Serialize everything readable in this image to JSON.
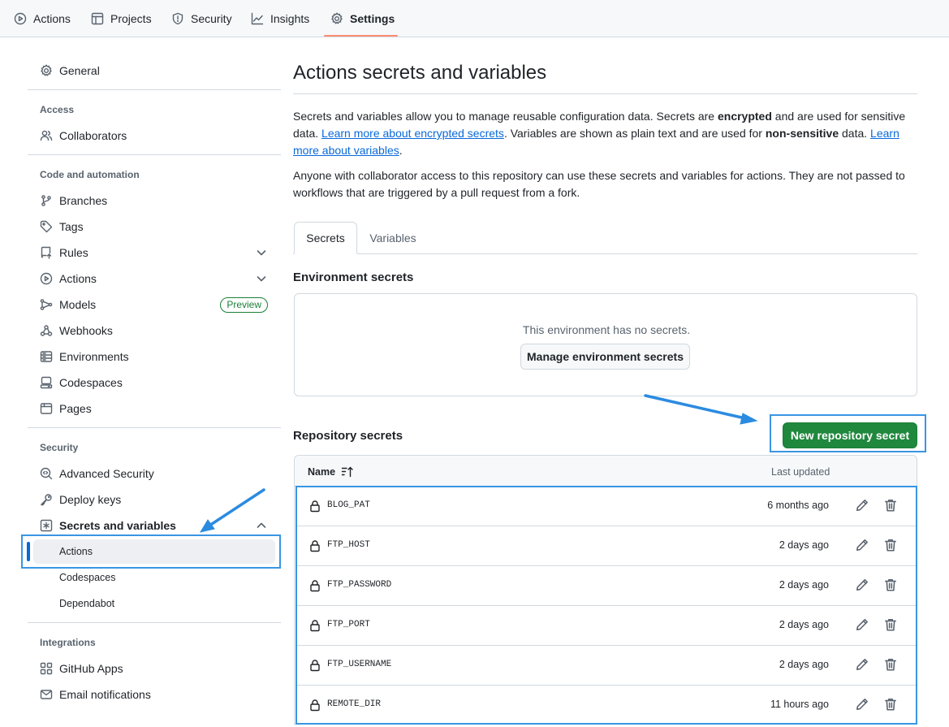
{
  "topnav": {
    "tabs": [
      {
        "label": "Actions",
        "icon": "play-icon"
      },
      {
        "label": "Projects",
        "icon": "table-icon"
      },
      {
        "label": "Security",
        "icon": "shield-icon"
      },
      {
        "label": "Insights",
        "icon": "graph-icon"
      },
      {
        "label": "Settings",
        "icon": "gear-icon",
        "active": true
      }
    ]
  },
  "sidebar": {
    "general": "General",
    "sections": {
      "access": "Access",
      "code_automation": "Code and automation",
      "security": "Security",
      "integrations": "Integrations"
    },
    "items": {
      "collaborators": "Collaborators",
      "branches": "Branches",
      "tags": "Tags",
      "rules": "Rules",
      "actions": "Actions",
      "models": "Models",
      "models_badge": "Preview",
      "webhooks": "Webhooks",
      "environments": "Environments",
      "codespaces": "Codespaces",
      "pages": "Pages",
      "advanced_security": "Advanced Security",
      "deploy_keys": "Deploy keys",
      "secrets_and_variables": "Secrets and variables",
      "sub_actions": "Actions",
      "sub_codespaces": "Codespaces",
      "sub_dependabot": "Dependabot",
      "github_apps": "GitHub Apps",
      "email_notifications": "Email notifications"
    }
  },
  "main": {
    "title": "Actions secrets and variables",
    "intro": {
      "t1": "Secrets and variables allow you to manage reusable configuration data. Secrets are ",
      "b1": "encrypted",
      "t2": " and are used for sensitive data. ",
      "link1": "Learn more about encrypted secrets",
      "t3": ". Variables are shown as plain text and are used for ",
      "b2": "non-sensitive",
      "t4": " data. ",
      "link2": "Learn more about variables",
      "t5": "."
    },
    "access_note": "Anyone with collaborator access to this repository can use these secrets and variables for actions. They are not passed to workflows that are triggered by a pull request from a fork.",
    "tabs": [
      "Secrets",
      "Variables"
    ],
    "env_secrets": {
      "heading": "Environment secrets",
      "empty_text": "This environment has no secrets.",
      "manage_button": "Manage environment secrets"
    },
    "repo_secrets": {
      "heading": "Repository secrets",
      "new_button": "New repository secret",
      "columns": {
        "name": "Name",
        "updated": "Last updated"
      },
      "rows": [
        {
          "name": "BLOG_PAT",
          "updated": "6 months ago"
        },
        {
          "name": "FTP_HOST",
          "updated": "2 days ago"
        },
        {
          "name": "FTP_PASSWORD",
          "updated": "2 days ago"
        },
        {
          "name": "FTP_PORT",
          "updated": "2 days ago"
        },
        {
          "name": "FTP_USERNAME",
          "updated": "2 days ago"
        },
        {
          "name": "REMOTE_DIR",
          "updated": "11 hours ago"
        }
      ]
    }
  },
  "colors": {
    "accent": "#0969da",
    "primary_button": "#1f883d",
    "annotation": "#3a95e3",
    "active_tab_underline": "#fd8c73"
  }
}
